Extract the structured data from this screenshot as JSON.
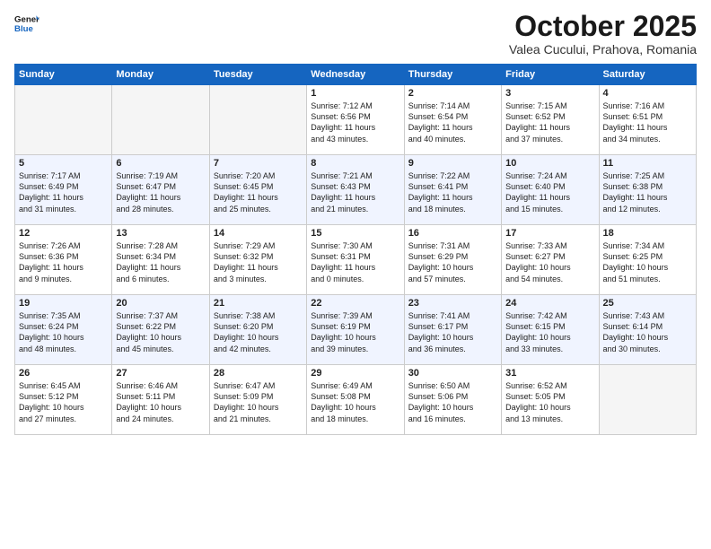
{
  "header": {
    "logo_general": "General",
    "logo_blue": "Blue",
    "month": "October 2025",
    "location": "Valea Cucului, Prahova, Romania"
  },
  "days_of_week": [
    "Sunday",
    "Monday",
    "Tuesday",
    "Wednesday",
    "Thursday",
    "Friday",
    "Saturday"
  ],
  "weeks": [
    [
      {
        "num": "",
        "text": ""
      },
      {
        "num": "",
        "text": ""
      },
      {
        "num": "",
        "text": ""
      },
      {
        "num": "1",
        "text": "Sunrise: 7:12 AM\nSunset: 6:56 PM\nDaylight: 11 hours\nand 43 minutes."
      },
      {
        "num": "2",
        "text": "Sunrise: 7:14 AM\nSunset: 6:54 PM\nDaylight: 11 hours\nand 40 minutes."
      },
      {
        "num": "3",
        "text": "Sunrise: 7:15 AM\nSunset: 6:52 PM\nDaylight: 11 hours\nand 37 minutes."
      },
      {
        "num": "4",
        "text": "Sunrise: 7:16 AM\nSunset: 6:51 PM\nDaylight: 11 hours\nand 34 minutes."
      }
    ],
    [
      {
        "num": "5",
        "text": "Sunrise: 7:17 AM\nSunset: 6:49 PM\nDaylight: 11 hours\nand 31 minutes."
      },
      {
        "num": "6",
        "text": "Sunrise: 7:19 AM\nSunset: 6:47 PM\nDaylight: 11 hours\nand 28 minutes."
      },
      {
        "num": "7",
        "text": "Sunrise: 7:20 AM\nSunset: 6:45 PM\nDaylight: 11 hours\nand 25 minutes."
      },
      {
        "num": "8",
        "text": "Sunrise: 7:21 AM\nSunset: 6:43 PM\nDaylight: 11 hours\nand 21 minutes."
      },
      {
        "num": "9",
        "text": "Sunrise: 7:22 AM\nSunset: 6:41 PM\nDaylight: 11 hours\nand 18 minutes."
      },
      {
        "num": "10",
        "text": "Sunrise: 7:24 AM\nSunset: 6:40 PM\nDaylight: 11 hours\nand 15 minutes."
      },
      {
        "num": "11",
        "text": "Sunrise: 7:25 AM\nSunset: 6:38 PM\nDaylight: 11 hours\nand 12 minutes."
      }
    ],
    [
      {
        "num": "12",
        "text": "Sunrise: 7:26 AM\nSunset: 6:36 PM\nDaylight: 11 hours\nand 9 minutes."
      },
      {
        "num": "13",
        "text": "Sunrise: 7:28 AM\nSunset: 6:34 PM\nDaylight: 11 hours\nand 6 minutes."
      },
      {
        "num": "14",
        "text": "Sunrise: 7:29 AM\nSunset: 6:32 PM\nDaylight: 11 hours\nand 3 minutes."
      },
      {
        "num": "15",
        "text": "Sunrise: 7:30 AM\nSunset: 6:31 PM\nDaylight: 11 hours\nand 0 minutes."
      },
      {
        "num": "16",
        "text": "Sunrise: 7:31 AM\nSunset: 6:29 PM\nDaylight: 10 hours\nand 57 minutes."
      },
      {
        "num": "17",
        "text": "Sunrise: 7:33 AM\nSunset: 6:27 PM\nDaylight: 10 hours\nand 54 minutes."
      },
      {
        "num": "18",
        "text": "Sunrise: 7:34 AM\nSunset: 6:25 PM\nDaylight: 10 hours\nand 51 minutes."
      }
    ],
    [
      {
        "num": "19",
        "text": "Sunrise: 7:35 AM\nSunset: 6:24 PM\nDaylight: 10 hours\nand 48 minutes."
      },
      {
        "num": "20",
        "text": "Sunrise: 7:37 AM\nSunset: 6:22 PM\nDaylight: 10 hours\nand 45 minutes."
      },
      {
        "num": "21",
        "text": "Sunrise: 7:38 AM\nSunset: 6:20 PM\nDaylight: 10 hours\nand 42 minutes."
      },
      {
        "num": "22",
        "text": "Sunrise: 7:39 AM\nSunset: 6:19 PM\nDaylight: 10 hours\nand 39 minutes."
      },
      {
        "num": "23",
        "text": "Sunrise: 7:41 AM\nSunset: 6:17 PM\nDaylight: 10 hours\nand 36 minutes."
      },
      {
        "num": "24",
        "text": "Sunrise: 7:42 AM\nSunset: 6:15 PM\nDaylight: 10 hours\nand 33 minutes."
      },
      {
        "num": "25",
        "text": "Sunrise: 7:43 AM\nSunset: 6:14 PM\nDaylight: 10 hours\nand 30 minutes."
      }
    ],
    [
      {
        "num": "26",
        "text": "Sunrise: 6:45 AM\nSunset: 5:12 PM\nDaylight: 10 hours\nand 27 minutes."
      },
      {
        "num": "27",
        "text": "Sunrise: 6:46 AM\nSunset: 5:11 PM\nDaylight: 10 hours\nand 24 minutes."
      },
      {
        "num": "28",
        "text": "Sunrise: 6:47 AM\nSunset: 5:09 PM\nDaylight: 10 hours\nand 21 minutes."
      },
      {
        "num": "29",
        "text": "Sunrise: 6:49 AM\nSunset: 5:08 PM\nDaylight: 10 hours\nand 18 minutes."
      },
      {
        "num": "30",
        "text": "Sunrise: 6:50 AM\nSunset: 5:06 PM\nDaylight: 10 hours\nand 16 minutes."
      },
      {
        "num": "31",
        "text": "Sunrise: 6:52 AM\nSunset: 5:05 PM\nDaylight: 10 hours\nand 13 minutes."
      },
      {
        "num": "",
        "text": ""
      }
    ]
  ]
}
